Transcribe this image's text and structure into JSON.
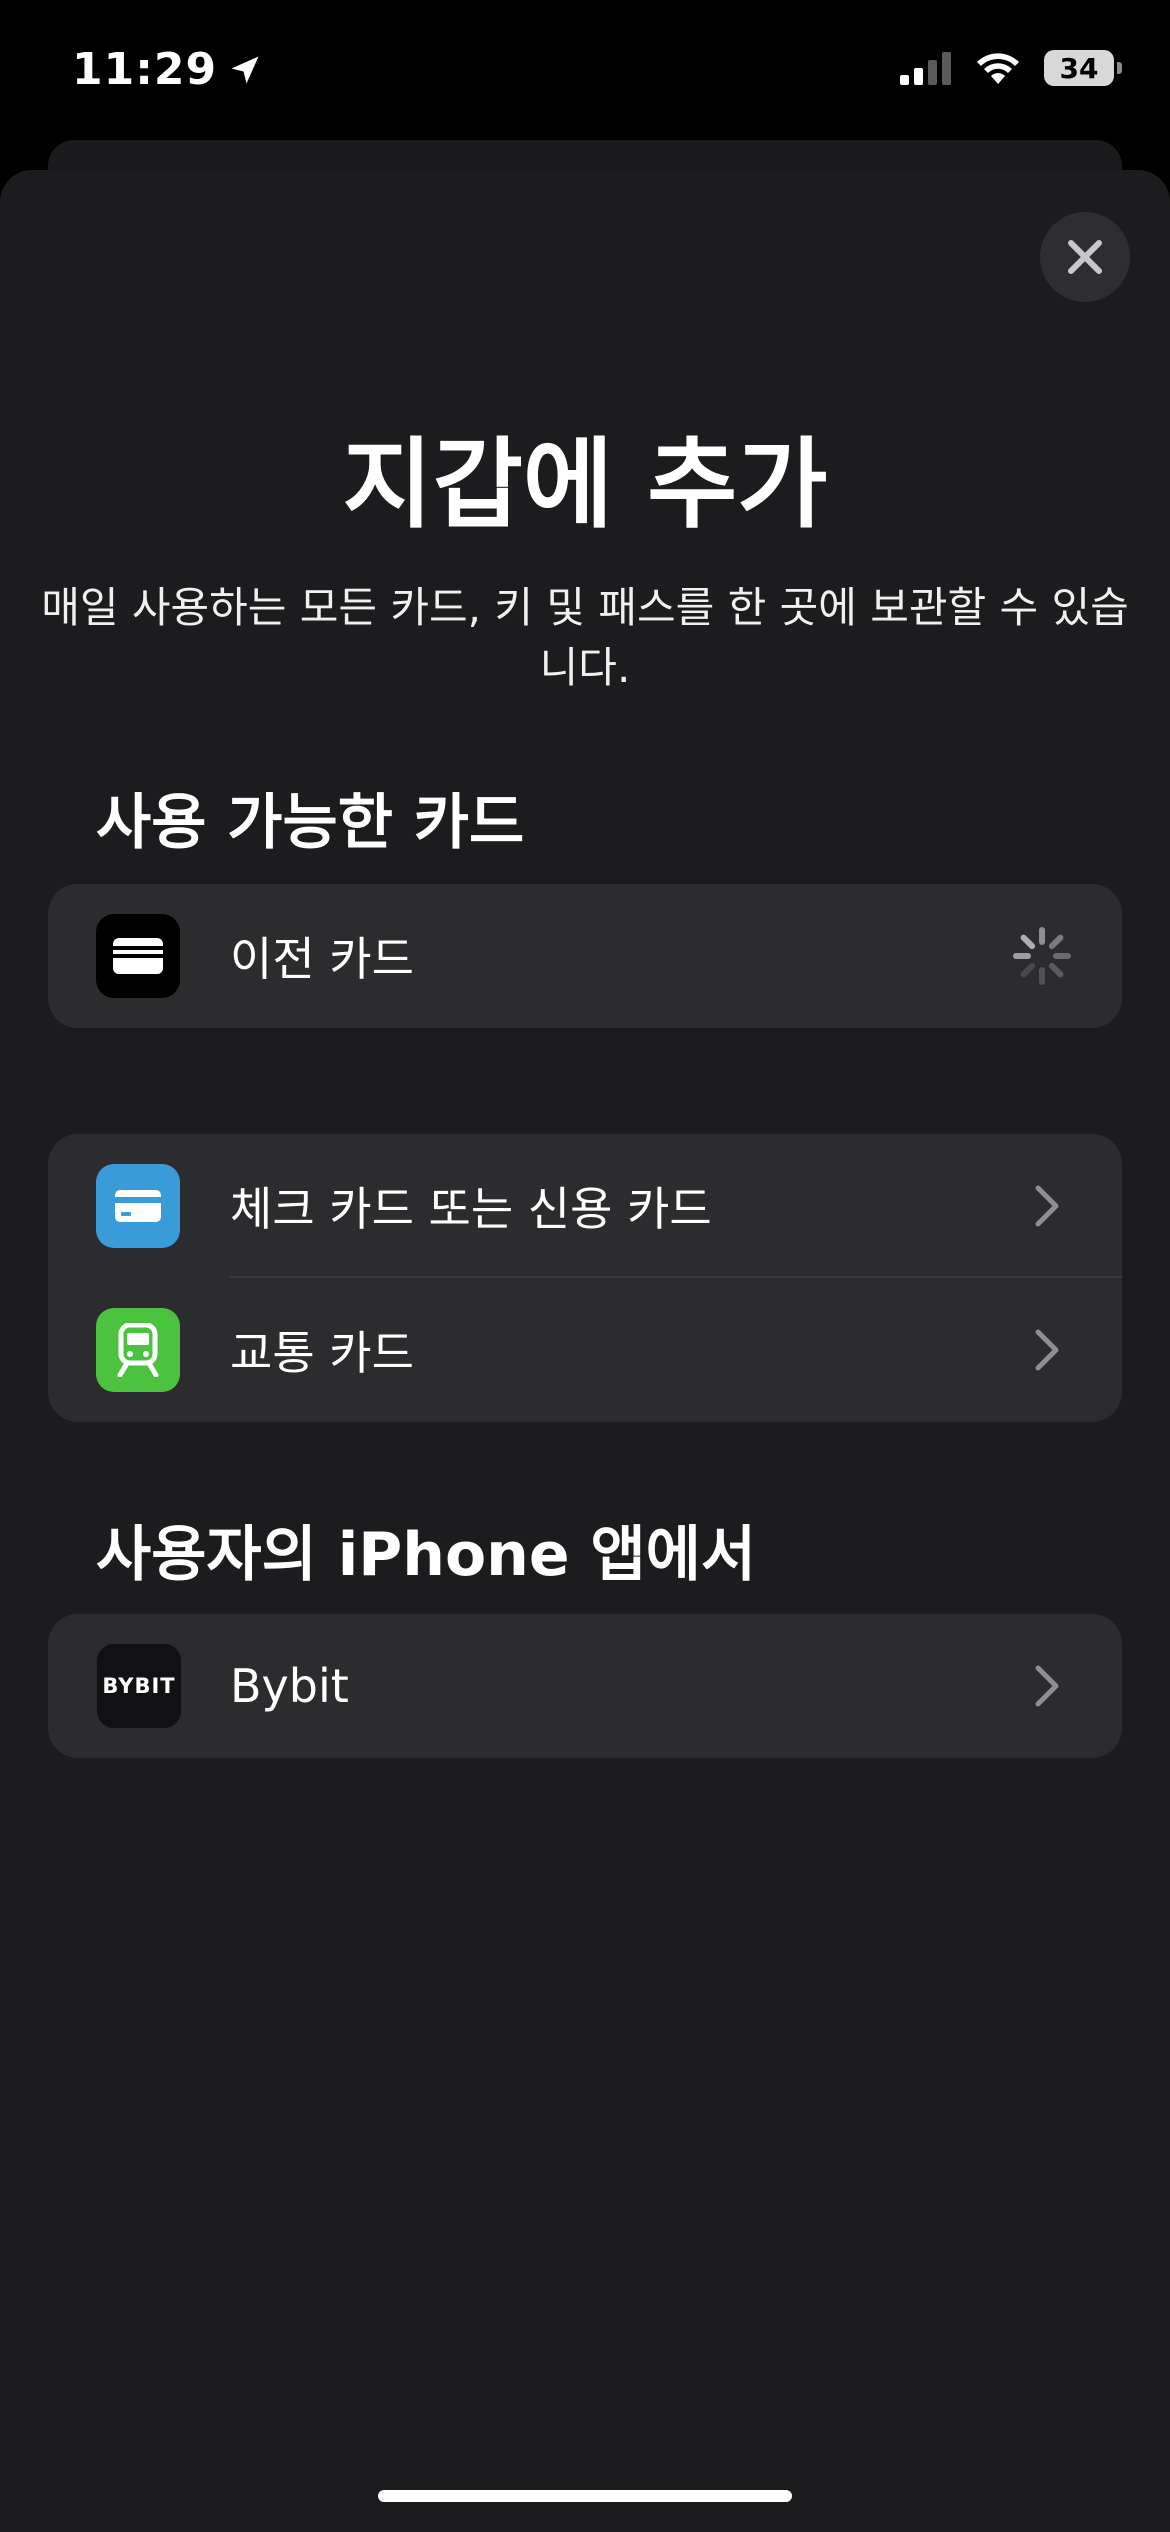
{
  "status_bar": {
    "time": "11:29",
    "battery": "34"
  },
  "sheet": {
    "title": "지갑에 추가",
    "subtitle": "매일 사용하는 모든 카드, 키 및 패스를 한 곳에 보관할 수 있습니다."
  },
  "sections": {
    "available_cards": "사용 가능한 카드",
    "from_apps": "사용자의 iPhone 앱에서"
  },
  "rows": {
    "previous_cards": "이전 카드",
    "debit_credit": "체크 카드 또는 신용 카드",
    "transit": "교통 카드",
    "bybit": "Bybit",
    "bybit_logo": "BYBIT"
  },
  "colors": {
    "sheet_bg": "#1c1c1e",
    "group_bg": "#2c2c2e",
    "card_icon_blue": "#3a9bd9",
    "transit_icon_green": "#4cc33f"
  },
  "icons": [
    "location-arrow-icon",
    "cellular-signal-icon",
    "wifi-icon",
    "close-icon",
    "wallet-icon",
    "credit-card-icon",
    "train-icon",
    "chevron-right-icon",
    "loading-spinner-icon"
  ]
}
